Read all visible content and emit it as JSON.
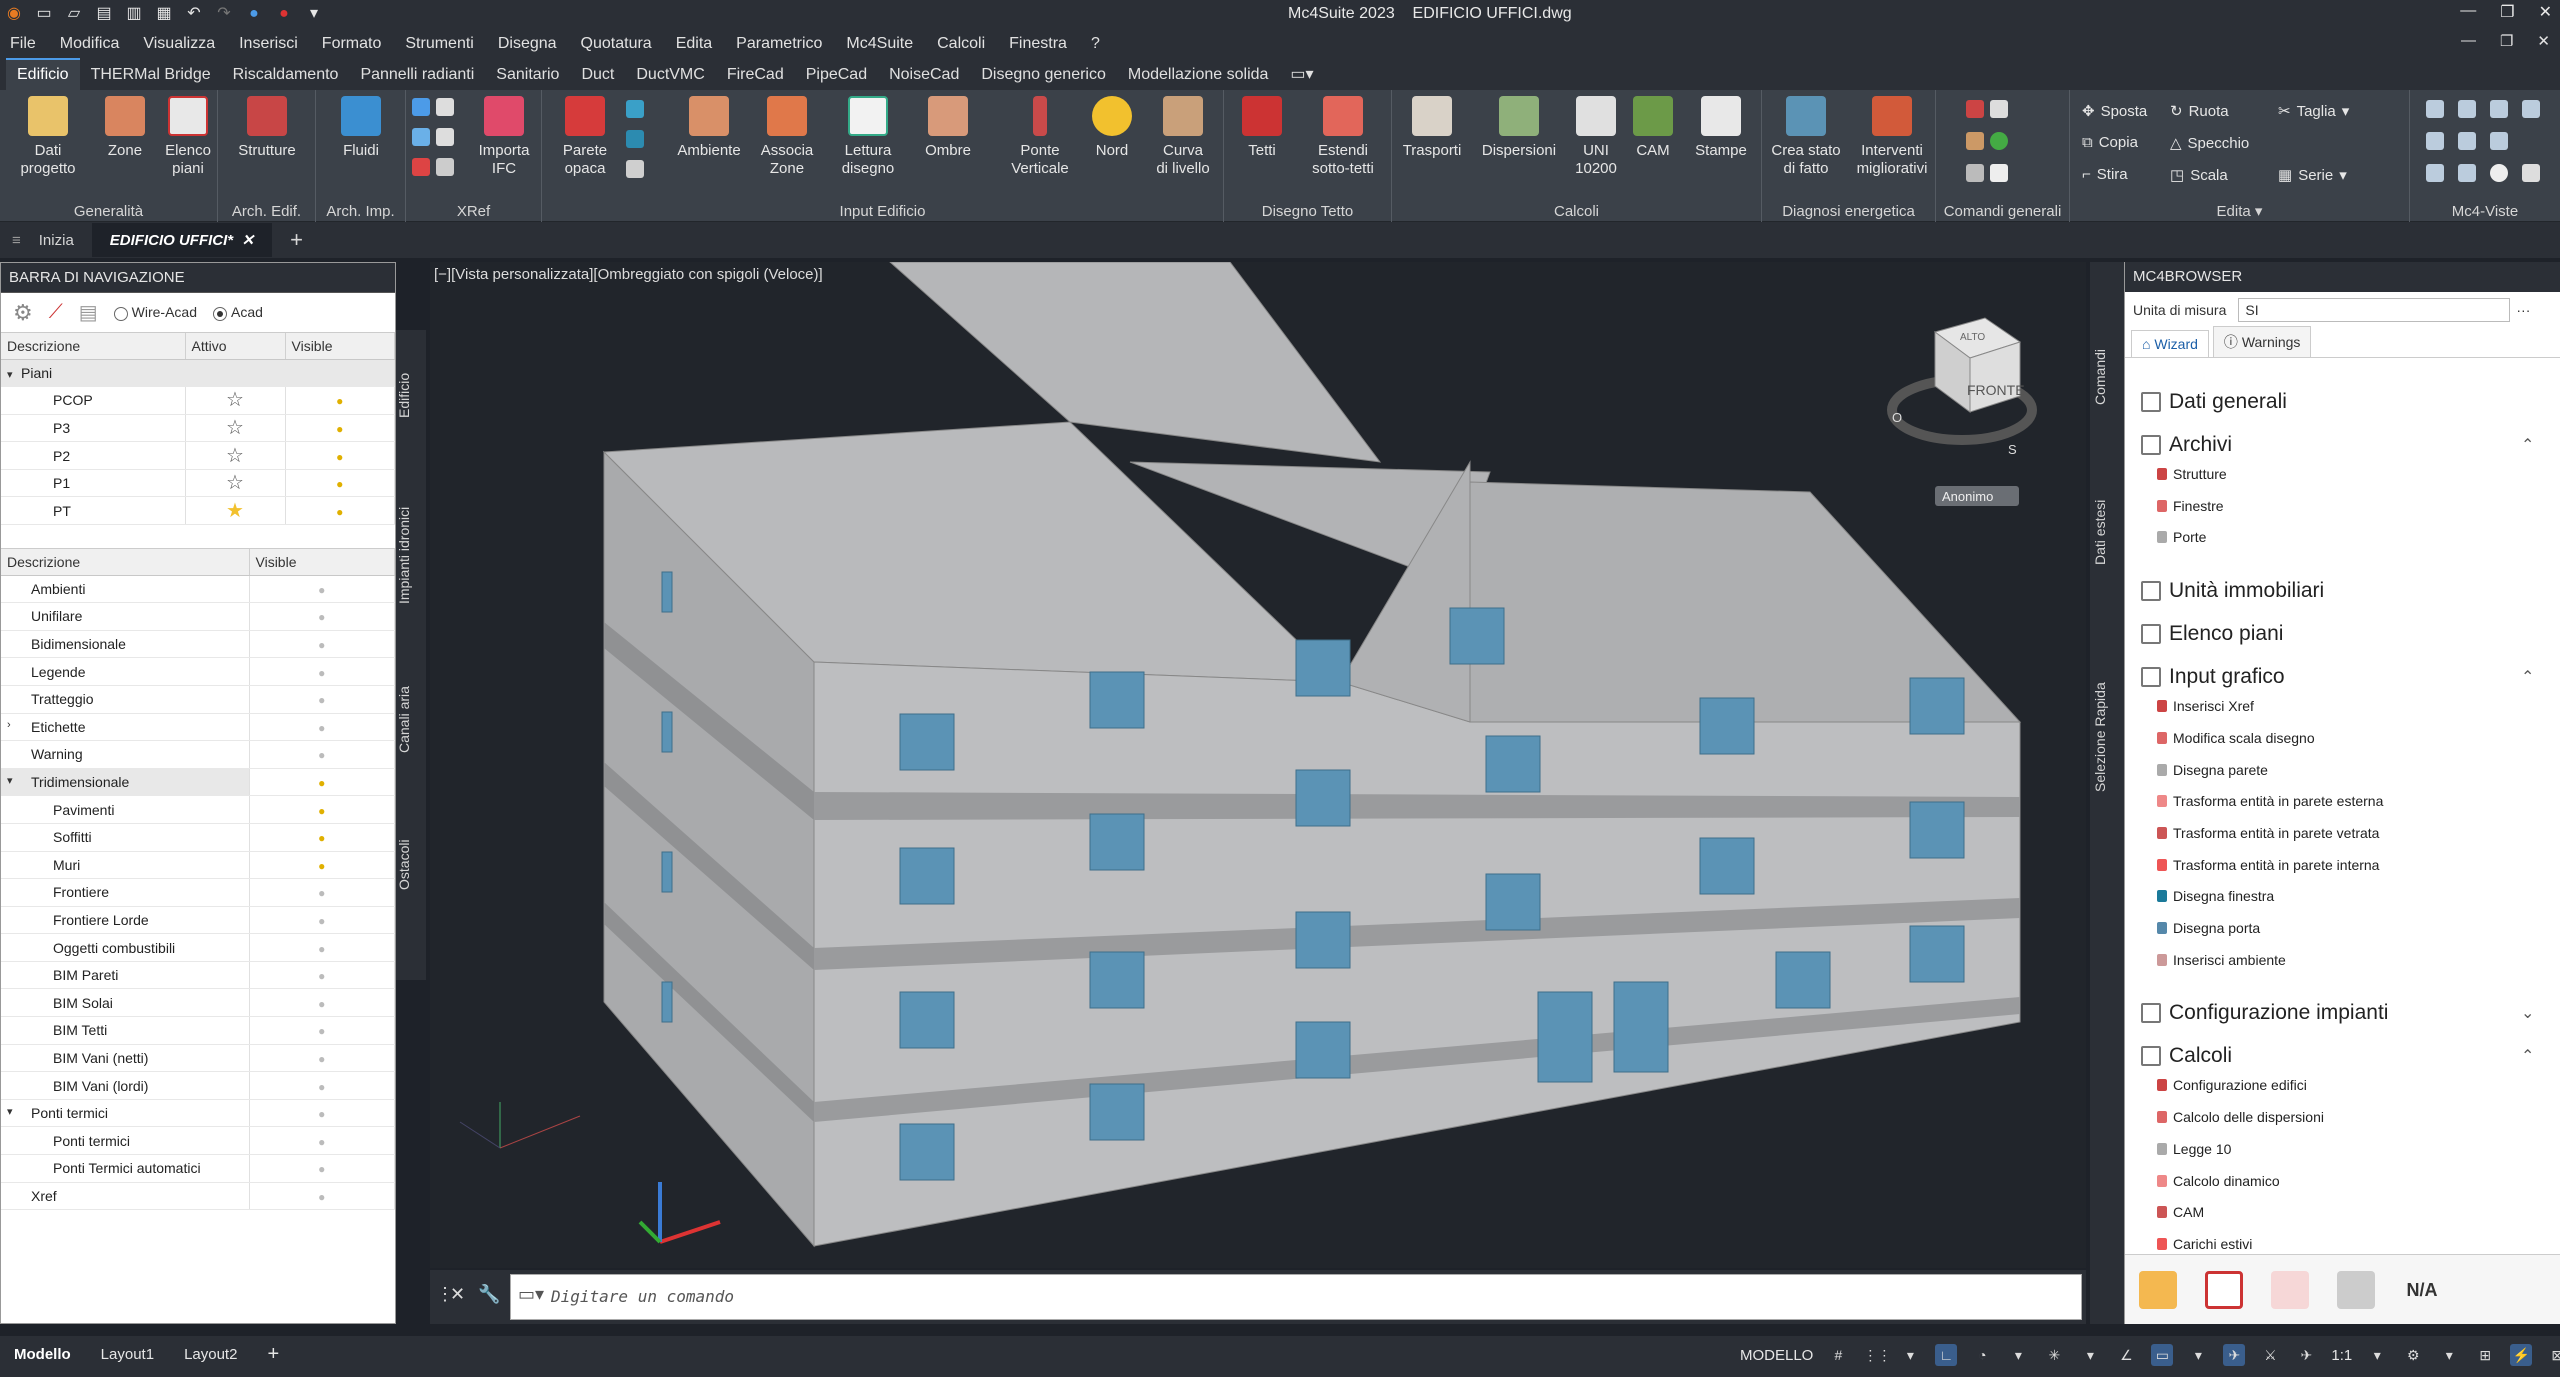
{
  "titlebar": {
    "app": "Mc4Suite 2023",
    "file": "EDIFICIO UFFICI.dwg",
    "qat_icons": [
      "app-icon",
      "new-icon",
      "open-icon",
      "save-icon",
      "save-as-icon",
      "print-icon",
      "undo-icon",
      "redo-icon",
      "share-icon",
      "dropdown-icon"
    ]
  },
  "menubar": {
    "items": [
      "File",
      "Modifica",
      "Visualizza",
      "Inserisci",
      "Formato",
      "Strumenti",
      "Disegna",
      "Quotatura",
      "Edita",
      "Parametrico",
      "Mc4Suite",
      "Calcoli",
      "Finestra",
      "?"
    ]
  },
  "ribbon_tabs": [
    "Edificio",
    "THERMal Bridge",
    "Riscaldamento",
    "Pannelli radianti",
    "Sanitario",
    "Duct",
    "DuctVMC",
    "FireCad",
    "PipeCad",
    "NoiseCad",
    "Disegno generico",
    "Modellazione solida"
  ],
  "ribbon": {
    "groups": [
      {
        "label": "Generalità",
        "buttons": [
          "Dati\nprogetto",
          "Zone",
          "Elenco\npiani"
        ]
      },
      {
        "label": "Arch. Edif.",
        "buttons": [
          "Strutture"
        ]
      },
      {
        "label": "Arch. Imp.",
        "buttons": [
          "Fluidi"
        ]
      },
      {
        "label": "XRef",
        "buttons": [
          "Importa\nIFC"
        ]
      },
      {
        "label": "Input Edificio",
        "buttons": [
          "Parete\nopaca",
          "Ambiente",
          "Associa\nZone",
          "Lettura\ndisegno",
          "Ombre",
          "Ponte\nVerticale",
          "Nord",
          "Curva\ndi livello"
        ]
      },
      {
        "label": "Disegno Tetto",
        "buttons": [
          "Tetti",
          "Estendi\nsotto-tetti"
        ]
      },
      {
        "label": "Calcoli",
        "buttons": [
          "Trasporti",
          "Dispersioni",
          "UNI\n10200",
          "CAM",
          "Stampe"
        ]
      },
      {
        "label": "Diagnosi energetica",
        "buttons": [
          "Crea stato\ndi fatto",
          "Interventi\nmigliorativi"
        ]
      },
      {
        "label": "Comandi generali",
        "buttons": []
      },
      {
        "label": "Edita",
        "small": [
          "Sposta",
          "Ruota",
          "Taglia",
          "Copia",
          "Specchio",
          "Stira",
          "Scala",
          "Serie"
        ]
      },
      {
        "label": "Mc4-Viste",
        "buttons": []
      }
    ]
  },
  "doc_tabs": [
    "Inizia",
    "EDIFICIO UFFICI*"
  ],
  "nav": {
    "title": "BARRA DI NAVIGAZIONE",
    "mode_wire": "Wire-Acad",
    "mode_acad": "Acad",
    "vtabs": [
      "Edificio",
      "Impianti idronici",
      "Canali aria",
      "Ostacoli"
    ],
    "floors_headers": [
      "Descrizione",
      "Attivo",
      "Visible"
    ],
    "floors_group": "Piani",
    "floors": [
      {
        "name": "PCOP",
        "active": false
      },
      {
        "name": "P3",
        "active": false
      },
      {
        "name": "P2",
        "active": false
      },
      {
        "name": "P1",
        "active": false
      },
      {
        "name": "PT",
        "active": true
      }
    ],
    "layers_headers": [
      "Descrizione",
      "Visible"
    ],
    "layers": [
      {
        "name": "Ambienti",
        "level": 0,
        "on": false
      },
      {
        "name": "Unifilare",
        "level": 0,
        "on": false
      },
      {
        "name": "Bidimensionale",
        "level": 0,
        "on": false
      },
      {
        "name": "Legende",
        "level": 0,
        "on": false
      },
      {
        "name": "Tratteggio",
        "level": 0,
        "on": false
      },
      {
        "name": "Etichette",
        "level": 0,
        "on": false,
        "expander": ">"
      },
      {
        "name": "Warning",
        "level": 0,
        "on": false
      },
      {
        "name": "Tridimensionale",
        "level": 0,
        "on": true,
        "expander": "v"
      },
      {
        "name": "Pavimenti",
        "level": 1,
        "on": true
      },
      {
        "name": "Soffitti",
        "level": 1,
        "on": true
      },
      {
        "name": "Muri",
        "level": 1,
        "on": true
      },
      {
        "name": "Frontiere",
        "level": 1,
        "on": false
      },
      {
        "name": "Frontiere Lorde",
        "level": 1,
        "on": false
      },
      {
        "name": "Oggetti combustibili",
        "level": 1,
        "on": false
      },
      {
        "name": "BIM Pareti",
        "level": 1,
        "on": false
      },
      {
        "name": "BIM Solai",
        "level": 1,
        "on": false
      },
      {
        "name": "BIM Tetti",
        "level": 1,
        "on": false
      },
      {
        "name": "BIM Vani (netti)",
        "level": 1,
        "on": false
      },
      {
        "name": "BIM Vani (lordi)",
        "level": 1,
        "on": false
      },
      {
        "name": "Ponti termici",
        "level": 0,
        "on": false,
        "expander": "v"
      },
      {
        "name": "Ponti termici",
        "level": 1,
        "on": false
      },
      {
        "name": "Ponti Termici automatici",
        "level": 1,
        "on": false
      },
      {
        "name": "Xref",
        "level": 0,
        "on": false
      }
    ]
  },
  "viewport": {
    "label": "[−][Vista personalizzata][Ombreggiato con spigoli (Veloce)]",
    "viewcube_front": "FRONTE",
    "viewcube_top": "ALTO",
    "compass_s": "S",
    "compass_o": "O",
    "ucs_name": "Anonimo"
  },
  "command": {
    "placeholder": "Digitare un comando"
  },
  "browser": {
    "title": "MC4BROWSER",
    "um_label": "Unita di misura",
    "um_value": "SI",
    "tabs": [
      "Wizard",
      "Warnings"
    ],
    "right_vtabs": [
      "Comandi",
      "Dati estesi",
      "Selezione Rapida"
    ],
    "sections": [
      {
        "title": "Dati generali",
        "items": []
      },
      {
        "title": "Archivi",
        "chev": "^",
        "items": [
          "Strutture",
          "Finestre",
          "Porte"
        ]
      },
      {
        "title": "Unità immobiliari",
        "items": []
      },
      {
        "title": "Elenco piani",
        "items": []
      },
      {
        "title": "Input grafico",
        "chev": "^",
        "items": [
          "Inserisci Xref",
          "Modifica scala disegno",
          "Disegna parete",
          "Trasforma entità in parete esterna",
          "Trasforma entità in parete vetrata",
          "Trasforma entità in parete interna",
          "Disegna finestra",
          "Disegna porta",
          "Inserisci ambiente"
        ]
      },
      {
        "title": "Configurazione impianti",
        "chev": "v",
        "items": []
      },
      {
        "title": "Calcoli",
        "chev": "^",
        "items": [
          "Configurazione edifici",
          "Calcolo delle dispersioni",
          "Legge 10",
          "Calcolo dinamico",
          "CAM",
          "Carichi estivi"
        ]
      }
    ],
    "footer_na": "N/A"
  },
  "status": {
    "layouts": [
      "Modello",
      "Layout1",
      "Layout2"
    ],
    "mode": "MODELLO",
    "scale": "1:1"
  },
  "colors": {
    "accent": "#4c9be8",
    "ribbon_bg": "#3b4149",
    "dark_bg": "#2b2f36",
    "building": "#b7b8ba",
    "window": "#5b93b5"
  }
}
